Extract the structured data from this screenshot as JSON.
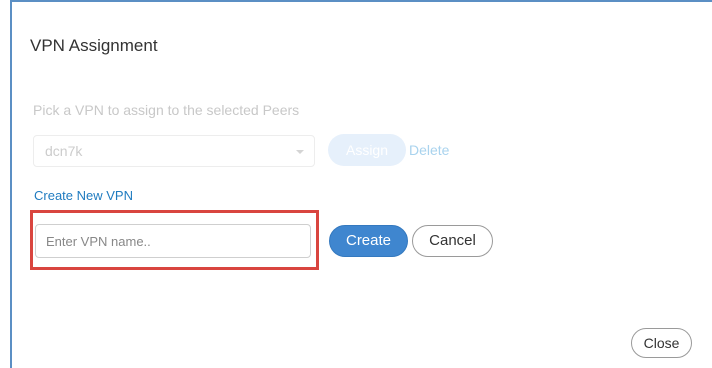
{
  "dialog": {
    "title": "VPN Assignment"
  },
  "assign_section": {
    "hint": "Pick a VPN to assign to the selected Peers",
    "selected_vpn": "dcn7k",
    "assign_label": "Assign",
    "delete_label": "Delete"
  },
  "create_section": {
    "link_label": "Create New VPN",
    "input_value": "",
    "input_placeholder": "Enter VPN name..",
    "create_label": "Create",
    "cancel_label": "Cancel"
  },
  "footer": {
    "close_label": "Close"
  },
  "colors": {
    "primary": "#3f86cf",
    "link": "#1f7bc0",
    "highlight": "#d9453f",
    "dialog_border": "#5b8fc4"
  },
  "icons": {
    "select_caret": "chevron-down-icon"
  }
}
